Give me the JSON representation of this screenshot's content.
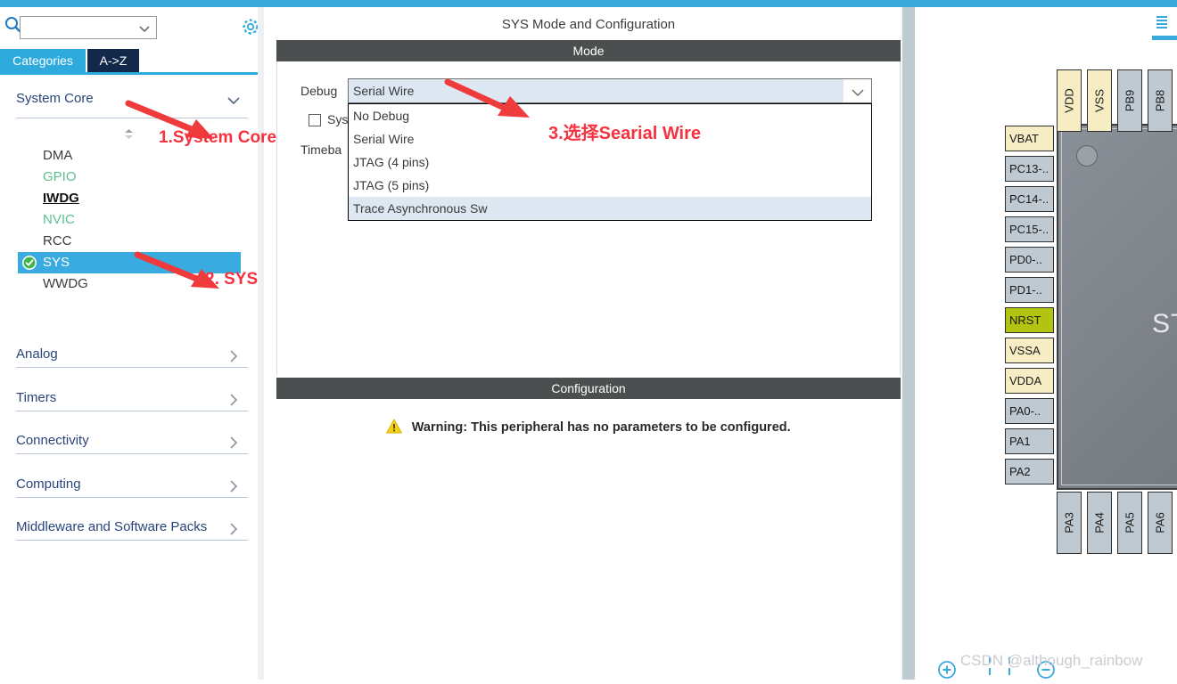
{
  "app": {
    "accent_blue": "#2eaadc",
    "dark_navy": "#12294b",
    "section_gray": "#4b4f4f",
    "select_blue": "#3aabe0",
    "annotation_red": "#f5333f"
  },
  "sidebar": {
    "search": {
      "value": "",
      "placeholder": "",
      "icon": "search-icon"
    },
    "gear_icon": "gear-icon",
    "tabs": [
      {
        "label": "Categories",
        "active": true
      },
      {
        "label": "A->Z",
        "active": false
      }
    ],
    "categories": [
      {
        "label": "System Core",
        "expanded": true,
        "chevron": "chevron-down-icon"
      },
      {
        "label": "Analog",
        "expanded": false,
        "chevron": "chevron-right-icon"
      },
      {
        "label": "Timers",
        "expanded": false,
        "chevron": "chevron-right-icon"
      },
      {
        "label": "Connectivity",
        "expanded": false,
        "chevron": "chevron-right-icon"
      },
      {
        "label": "Computing",
        "expanded": false,
        "chevron": "chevron-right-icon"
      },
      {
        "label": "Middleware and Software Packs",
        "expanded": false,
        "chevron": "chevron-right-icon"
      }
    ],
    "system_core_items": [
      {
        "label": "DMA",
        "state": "normal",
        "selected": false,
        "checked": false
      },
      {
        "label": "GPIO",
        "state": "configured",
        "selected": false,
        "checked": false
      },
      {
        "label": "IWDG",
        "state": "bold",
        "selected": false,
        "checked": false
      },
      {
        "label": "NVIC",
        "state": "configured",
        "selected": false,
        "checked": false
      },
      {
        "label": "RCC",
        "state": "normal",
        "selected": false,
        "checked": false
      },
      {
        "label": "SYS",
        "state": "normal",
        "selected": true,
        "checked": true
      },
      {
        "label": "WWDG",
        "state": "normal",
        "selected": false,
        "checked": false
      }
    ]
  },
  "main": {
    "title": "SYS Mode and Configuration",
    "mode_section": {
      "header": "Mode",
      "debug_label": "Debug",
      "debug_value": "Serial Wire",
      "debug_options": [
        {
          "label": "No Debug",
          "highlighted": false
        },
        {
          "label": "Serial Wire",
          "highlighted": false
        },
        {
          "label": "JTAG (4 pins)",
          "highlighted": false
        },
        {
          "label": "JTAG (5 pins)",
          "highlighted": false
        },
        {
          "label": "Trace Asynchronous Sw",
          "highlighted": true
        }
      ],
      "system_wake_up_label": "Sys",
      "timebase_label": "Timeba"
    },
    "config_section": {
      "header": "Configuration",
      "warning_icon": "warning-triangle-icon",
      "warning_text": "Warning: This peripheral has no parameters to be configured."
    }
  },
  "chip": {
    "brand_text": "ST",
    "top_pins": [
      {
        "label": "VDD",
        "color": "cream"
      },
      {
        "label": "VSS",
        "color": "cream"
      },
      {
        "label": "PB9",
        "color": "gray"
      },
      {
        "label": "PB8",
        "color": "gray"
      }
    ],
    "left_pins": [
      {
        "label": "VBAT",
        "color": "cream"
      },
      {
        "label": "PC13-..",
        "color": "gray"
      },
      {
        "label": "PC14-..",
        "color": "gray"
      },
      {
        "label": "PC15-..",
        "color": "gray"
      },
      {
        "label": "PD0-..",
        "color": "gray"
      },
      {
        "label": "PD1-..",
        "color": "gray"
      },
      {
        "label": "NRST",
        "color": "green"
      },
      {
        "label": "VSSA",
        "color": "cream"
      },
      {
        "label": "VDDA",
        "color": "cream"
      },
      {
        "label": "PA0-..",
        "color": "gray"
      },
      {
        "label": "PA1",
        "color": "gray"
      },
      {
        "label": "PA2",
        "color": "gray"
      }
    ],
    "bottom_pins": [
      {
        "label": "PA3",
        "color": "gray"
      },
      {
        "label": "PA4",
        "color": "gray"
      },
      {
        "label": "PA5",
        "color": "gray"
      },
      {
        "label": "PA6",
        "color": "gray"
      }
    ],
    "zoom_controls": [
      {
        "name": "zoom-in-button",
        "icon": "plus-circle-icon"
      },
      {
        "name": "zoom-out-button",
        "icon": "minus-circle-icon"
      },
      {
        "name": "zoom-fit-button",
        "icon": "fit-screen-icon"
      }
    ]
  },
  "watermark": "CSDN @although_rainbow",
  "annotations": [
    {
      "id": "anno1",
      "text": "1.System Core"
    },
    {
      "id": "anno2",
      "text": "2. SYS"
    },
    {
      "id": "anno3",
      "text": "3.选择Searial Wire"
    }
  ]
}
